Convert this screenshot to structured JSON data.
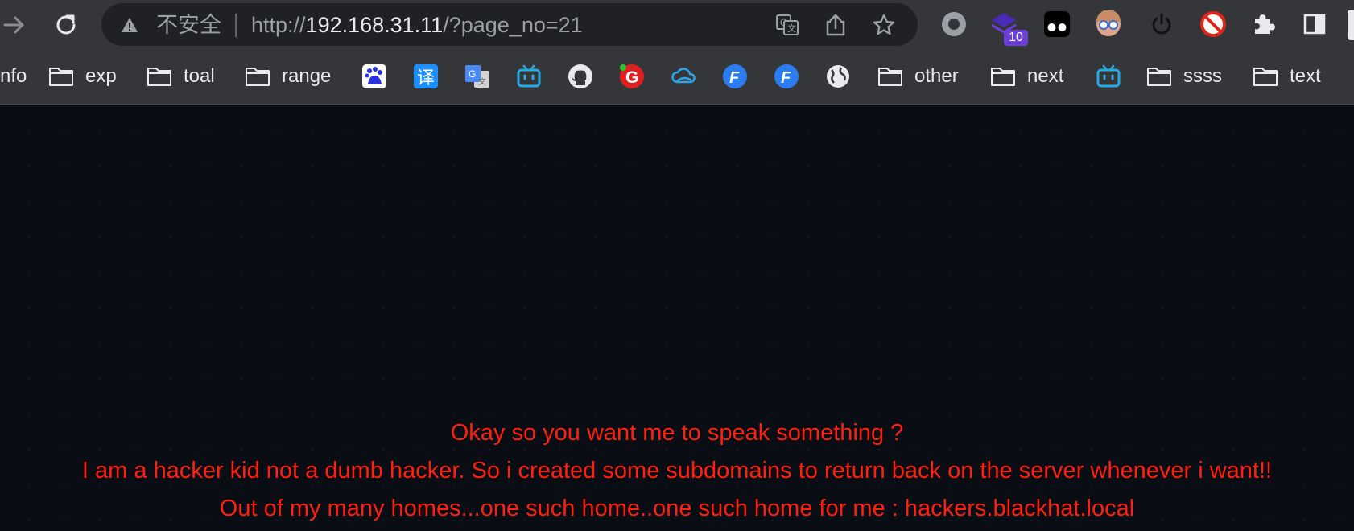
{
  "browser": {
    "omnibox": {
      "security_label": "不安全",
      "url_scheme": "http://",
      "url_host": "192.168.31.11",
      "url_path": "/?page_no=21"
    },
    "extensions": {
      "badge_count": "10"
    }
  },
  "bookmarks": {
    "info": "nfo",
    "exp": "exp",
    "toal": "toal",
    "range": "range",
    "other": "other",
    "next": "next",
    "ssss": "ssss",
    "text": "text"
  },
  "page": {
    "line1": "Okay so you want me to speak something ?",
    "line2": "I am a hacker kid not a dumb hacker. So i created some subdomains to return back on the server whenever i want!!",
    "line3": "Out of my many homes...one such home..one such home for me : hackers.blackhat.local"
  },
  "colors": {
    "page_bg": "#0b0d15",
    "message_text": "#ff1f0f",
    "toolbar_bg": "#35363a",
    "omnibox_bg": "#202124"
  }
}
